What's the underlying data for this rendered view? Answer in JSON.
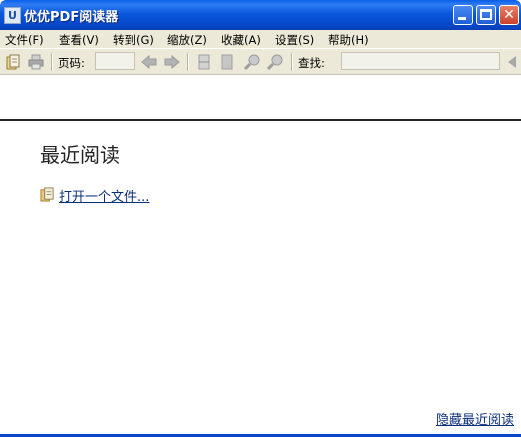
{
  "window": {
    "title": "优优PDF阅读器",
    "icon_letter": "U"
  },
  "menu": [
    {
      "label": "文件(F)"
    },
    {
      "label": "查看(V)"
    },
    {
      "label": "转到(G)"
    },
    {
      "label": "缩放(Z)"
    },
    {
      "label": "收藏(A)"
    },
    {
      "label": "设置(S)"
    },
    {
      "label": "帮助(H)"
    }
  ],
  "toolbar": {
    "page_label": "页码:",
    "page_value": "",
    "find_label": "查找:",
    "find_value": ""
  },
  "content": {
    "recent_title": "最近阅读",
    "open_file_link": "打开一个文件...",
    "hide_recent_link": "隐藏最近阅读"
  },
  "colors": {
    "titlebar": "#0b58dc",
    "chrome": "#ece9d8",
    "link": "#0a2f7a"
  }
}
